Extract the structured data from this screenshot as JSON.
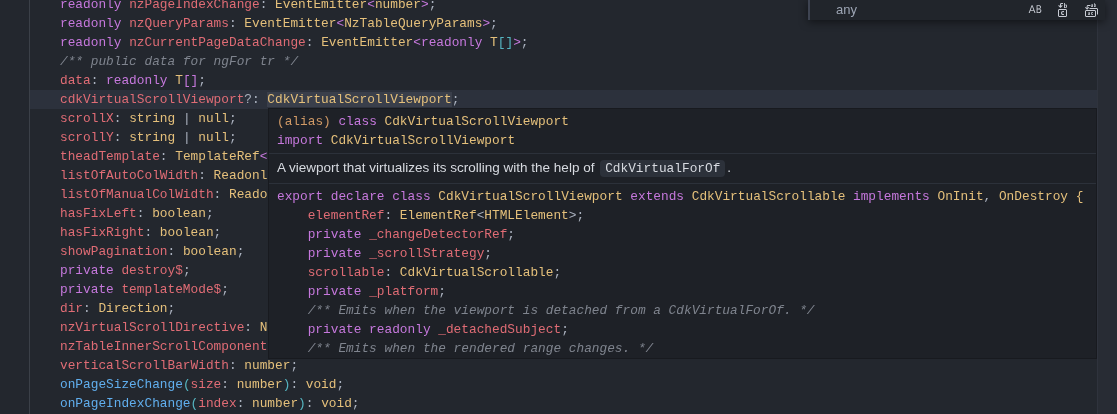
{
  "editor": {
    "lines": [
      {
        "current": false,
        "tokens": [
          {
            "kind": "kw",
            "t": "readonly "
          },
          {
            "kind": "prop",
            "t": "nzPageIndexChange"
          },
          {
            "kind": "p",
            "t": ": "
          },
          {
            "kind": "type",
            "t": "EventEmitter"
          },
          {
            "kind": "br2",
            "t": "<"
          },
          {
            "kind": "type",
            "t": "number"
          },
          {
            "kind": "br2",
            "t": ">"
          },
          {
            "kind": "p",
            "t": ";"
          }
        ]
      },
      {
        "current": false,
        "tokens": [
          {
            "kind": "kw",
            "t": "readonly "
          },
          {
            "kind": "prop",
            "t": "nzQueryParams"
          },
          {
            "kind": "p",
            "t": ": "
          },
          {
            "kind": "type",
            "t": "EventEmitter"
          },
          {
            "kind": "br2",
            "t": "<"
          },
          {
            "kind": "type",
            "t": "NzTableQueryParams"
          },
          {
            "kind": "br2",
            "t": ">"
          },
          {
            "kind": "p",
            "t": ";"
          }
        ]
      },
      {
        "current": false,
        "tokens": [
          {
            "kind": "kw",
            "t": "readonly "
          },
          {
            "kind": "prop",
            "t": "nzCurrentPageDataChange"
          },
          {
            "kind": "p",
            "t": ": "
          },
          {
            "kind": "type",
            "t": "EventEmitter"
          },
          {
            "kind": "br2",
            "t": "<"
          },
          {
            "kind": "kw",
            "t": "readonly "
          },
          {
            "kind": "type",
            "t": "T"
          },
          {
            "kind": "br3",
            "t": "[]"
          },
          {
            "kind": "br2",
            "t": ">"
          },
          {
            "kind": "p",
            "t": ";"
          }
        ]
      },
      {
        "current": false,
        "tokens": [
          {
            "kind": "comment",
            "t": "/** public data for ngFor tr */"
          }
        ]
      },
      {
        "current": false,
        "tokens": [
          {
            "kind": "prop",
            "t": "data"
          },
          {
            "kind": "p",
            "t": ": "
          },
          {
            "kind": "kw",
            "t": "readonly "
          },
          {
            "kind": "type",
            "t": "T"
          },
          {
            "kind": "br2",
            "t": "[]"
          },
          {
            "kind": "p",
            "t": ";"
          }
        ]
      },
      {
        "current": true,
        "tokens": [
          {
            "kind": "prop",
            "t": "cdkVirtualScrollViewport"
          },
          {
            "kind": "p",
            "t": "?: "
          },
          {
            "kind": "match",
            "t": "CdkVirtualScrollViewport"
          },
          {
            "kind": "p",
            "t": ";"
          }
        ]
      },
      {
        "current": false,
        "tokens": [
          {
            "kind": "prop",
            "t": "scrollX"
          },
          {
            "kind": "p",
            "t": ": "
          },
          {
            "kind": "type",
            "t": "string"
          },
          {
            "kind": "p",
            "t": " | "
          },
          {
            "kind": "type",
            "t": "null"
          },
          {
            "kind": "p",
            "t": ";"
          }
        ]
      },
      {
        "current": false,
        "tokens": [
          {
            "kind": "prop",
            "t": "scrollY"
          },
          {
            "kind": "p",
            "t": ": "
          },
          {
            "kind": "type",
            "t": "string"
          },
          {
            "kind": "p",
            "t": " | "
          },
          {
            "kind": "type",
            "t": "null"
          },
          {
            "kind": "p",
            "t": ";"
          }
        ]
      },
      {
        "current": false,
        "tokens": [
          {
            "kind": "prop",
            "t": "theadTemplate"
          },
          {
            "kind": "p",
            "t": ": "
          },
          {
            "kind": "type",
            "t": "TemplateRef"
          },
          {
            "kind": "br2",
            "t": "<"
          }
        ]
      },
      {
        "current": false,
        "tokens": [
          {
            "kind": "prop",
            "t": "listOfAutoColWidth"
          },
          {
            "kind": "p",
            "t": ": "
          },
          {
            "kind": "type",
            "t": "Readonl"
          }
        ]
      },
      {
        "current": false,
        "tokens": [
          {
            "kind": "prop",
            "t": "listOfManualColWidth"
          },
          {
            "kind": "p",
            "t": ": "
          },
          {
            "kind": "type",
            "t": "Reado"
          }
        ]
      },
      {
        "current": false,
        "tokens": [
          {
            "kind": "prop",
            "t": "hasFixLeft"
          },
          {
            "kind": "p",
            "t": ": "
          },
          {
            "kind": "type",
            "t": "boolean"
          },
          {
            "kind": "p",
            "t": ";"
          }
        ]
      },
      {
        "current": false,
        "tokens": [
          {
            "kind": "prop",
            "t": "hasFixRight"
          },
          {
            "kind": "p",
            "t": ": "
          },
          {
            "kind": "type",
            "t": "boolean"
          },
          {
            "kind": "p",
            "t": ";"
          }
        ]
      },
      {
        "current": false,
        "tokens": [
          {
            "kind": "prop",
            "t": "showPagination"
          },
          {
            "kind": "p",
            "t": ": "
          },
          {
            "kind": "type",
            "t": "boolean"
          },
          {
            "kind": "p",
            "t": ";"
          }
        ]
      },
      {
        "current": false,
        "tokens": [
          {
            "kind": "kw",
            "t": "private "
          },
          {
            "kind": "prop",
            "t": "destroy$"
          },
          {
            "kind": "p",
            "t": ";"
          }
        ]
      },
      {
        "current": false,
        "tokens": [
          {
            "kind": "kw",
            "t": "private "
          },
          {
            "kind": "prop",
            "t": "templateMode$"
          },
          {
            "kind": "p",
            "t": ";"
          }
        ]
      },
      {
        "current": false,
        "tokens": [
          {
            "kind": "prop",
            "t": "dir"
          },
          {
            "kind": "p",
            "t": ": "
          },
          {
            "kind": "type",
            "t": "Direction"
          },
          {
            "kind": "p",
            "t": ";"
          }
        ]
      },
      {
        "current": false,
        "tokens": [
          {
            "kind": "prop",
            "t": "nzVirtualScrollDirective"
          },
          {
            "kind": "p",
            "t": ": "
          },
          {
            "kind": "type",
            "t": "N"
          }
        ]
      },
      {
        "current": false,
        "tokens": [
          {
            "kind": "prop",
            "t": "nzTableInnerScrollComponent"
          }
        ]
      },
      {
        "current": false,
        "tokens": [
          {
            "kind": "prop",
            "t": "verticalScrollBarWidth"
          },
          {
            "kind": "p",
            "t": ": "
          },
          {
            "kind": "type",
            "t": "number"
          },
          {
            "kind": "p",
            "t": ";"
          }
        ]
      },
      {
        "current": false,
        "tokens": [
          {
            "kind": "fn",
            "t": "onPageSizeChange"
          },
          {
            "kind": "br3",
            "t": "("
          },
          {
            "kind": "prop",
            "t": "size"
          },
          {
            "kind": "p",
            "t": ": "
          },
          {
            "kind": "type",
            "t": "number"
          },
          {
            "kind": "br3",
            "t": ")"
          },
          {
            "kind": "p",
            "t": ": "
          },
          {
            "kind": "type",
            "t": "void"
          },
          {
            "kind": "p",
            "t": ";"
          }
        ]
      },
      {
        "current": false,
        "tokens": [
          {
            "kind": "fn",
            "t": "onPageIndexChange"
          },
          {
            "kind": "br3",
            "t": "("
          },
          {
            "kind": "prop",
            "t": "index"
          },
          {
            "kind": "p",
            "t": ": "
          },
          {
            "kind": "type",
            "t": "number"
          },
          {
            "kind": "br3",
            "t": ")"
          },
          {
            "kind": "p",
            "t": ": "
          },
          {
            "kind": "type",
            "t": "void"
          },
          {
            "kind": "p",
            "t": ";"
          }
        ]
      }
    ]
  },
  "hover": {
    "signature": [
      [
        {
          "kind": "num",
          "t": "(alias) "
        },
        {
          "kind": "kw",
          "t": "class "
        },
        {
          "kind": "type",
          "t": "CdkVirtualScrollViewport"
        }
      ],
      [
        {
          "kind": "kw",
          "t": "import "
        },
        {
          "kind": "type",
          "t": "CdkVirtualScrollViewport"
        }
      ]
    ],
    "description": [
      {
        "kind": "text",
        "t": "A viewport that virtualizes its scrolling with the help of "
      },
      {
        "kind": "code",
        "t": "CdkVirtualForOf"
      },
      {
        "kind": "text",
        "t": "."
      }
    ],
    "code": {
      "tokens": [
        {
          "kind": "kw",
          "t": "export declare class "
        },
        {
          "kind": "type",
          "t": "CdkVirtualScrollViewport "
        },
        {
          "kind": "kw",
          "t": "extends "
        },
        {
          "kind": "type",
          "t": "CdkVirtualScrollable "
        },
        {
          "kind": "kw",
          "t": "implements "
        },
        {
          "kind": "type",
          "t": "OnInit"
        },
        {
          "kind": "p",
          "t": ", "
        },
        {
          "kind": "type",
          "t": "OnDestroy "
        },
        {
          "kind": "type",
          "t": "{"
        }
      ],
      "children": [
        {
          "tokens": [
            {
              "kind": "prop",
              "t": "elementRef"
            },
            {
              "kind": "p",
              "t": ": "
            },
            {
              "kind": "type",
              "t": "ElementRef"
            },
            {
              "kind": "p",
              "t": "<"
            },
            {
              "kind": "type",
              "t": "HTMLElement"
            },
            {
              "kind": "p",
              "t": ">;"
            }
          ]
        },
        {
          "tokens": [
            {
              "kind": "kw",
              "t": "private "
            },
            {
              "kind": "prop",
              "t": "_changeDetectorRef"
            },
            {
              "kind": "p",
              "t": ";"
            }
          ]
        },
        {
          "tokens": [
            {
              "kind": "kw",
              "t": "private "
            },
            {
              "kind": "prop",
              "t": "_scrollStrategy"
            },
            {
              "kind": "p",
              "t": ";"
            }
          ]
        },
        {
          "tokens": [
            {
              "kind": "prop",
              "t": "scrollable"
            },
            {
              "kind": "p",
              "t": ": "
            },
            {
              "kind": "type",
              "t": "CdkVirtualScrollable"
            },
            {
              "kind": "p",
              "t": ";"
            }
          ]
        },
        {
          "tokens": [
            {
              "kind": "kw",
              "t": "private "
            },
            {
              "kind": "prop",
              "t": "_platform"
            },
            {
              "kind": "p",
              "t": ";"
            }
          ]
        },
        {
          "tokens": [
            {
              "kind": "comment",
              "t": "/** Emits when the viewport is detached from a CdkVirtualForOf. */"
            }
          ]
        },
        {
          "tokens": [
            {
              "kind": "kw",
              "t": "private readonly "
            },
            {
              "kind": "prop",
              "t": "_detachedSubject"
            },
            {
              "kind": "p",
              "t": ";"
            }
          ]
        },
        {
          "tokens": [
            {
              "kind": "comment",
              "t": "/** Emits when the rendered range changes. */"
            }
          ]
        }
      ]
    }
  },
  "replace_widget": {
    "value": "any"
  }
}
